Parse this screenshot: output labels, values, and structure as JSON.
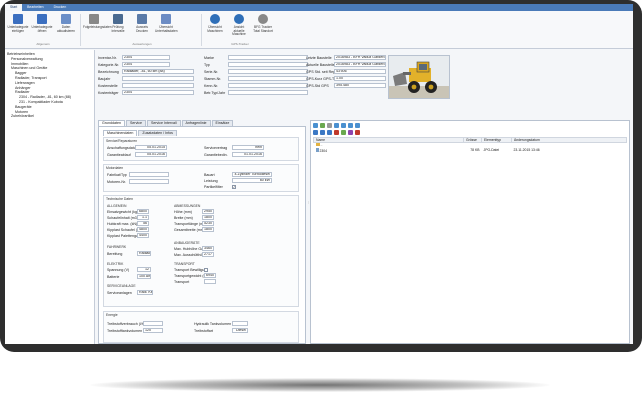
{
  "ribbon": {
    "tabs": [
      "Start",
      "Bearbeiten",
      "Drucken"
    ],
    "buttons": [
      {
        "label": "Unterkategorie einfügen",
        "color": "#3b6fc0"
      },
      {
        "label": "Unterkategorie öffnen",
        "color": "#3b6fc0"
      },
      {
        "label": "Daten aktualisieren",
        "color": "#6b8fc8"
      },
      {
        "label": "Folgeleistungsdaten",
        "color": "#888888"
      },
      {
        "label": "Prüfung Intervalle",
        "color": "#4a6a90"
      },
      {
        "label": "Ausweis Drucken",
        "color": "#5a7aa8"
      },
      {
        "label": "Übersicht Unterhaltsdaten",
        "color": "#6c8cc4"
      },
      {
        "label": "Übersicht Maschinen",
        "color": "#2f6fb8"
      },
      {
        "label": "Ansicht aktuelle Maschine",
        "color": "#2f6fb8"
      },
      {
        "label": "BFG Tracker Total Standort",
        "color": "#888888"
      }
    ],
    "groups": [
      "Allgemein",
      "Auswertungen",
      "GPS-Tracker"
    ]
  },
  "tree": [
    {
      "label": "Betriebseinheiten",
      "level": 0
    },
    {
      "label": "Personalverwaltung",
      "level": 1
    },
    {
      "label": "Immobilien",
      "level": 1
    },
    {
      "label": "Maschinen und Geräte",
      "level": 1
    },
    {
      "label": "Bagger",
      "level": 2
    },
    {
      "label": "Radlader, Transport",
      "level": 2
    },
    {
      "label": "Lieferwagen",
      "level": 2
    },
    {
      "label": "Anhänger",
      "level": 2
    },
    {
      "label": "Radlader",
      "level": 2
    },
    {
      "label": "2304 - Radlader, -81, 60 km (88)",
      "level": 3
    },
    {
      "label": "231 - Kompaktlader Kubota",
      "level": 3
    },
    {
      "label": "Baugeräte",
      "level": 2
    },
    {
      "label": "Motoren",
      "level": 2
    },
    {
      "label": "Zubehörartikel",
      "level": 1
    }
  ],
  "header": {
    "left_fields": [
      {
        "label": "Inventar-Nr.",
        "value": "2304"
      },
      {
        "label": "Kategorie-Nr.",
        "value": "2304"
      },
      {
        "label": "Bezeichnung",
        "value": "Radlader, -81, 60 km (88)"
      },
      {
        "label": "Baujahr",
        "value": ""
      },
      {
        "label": "Kostenstelle",
        "value": ""
      },
      {
        "label": "Kostenträger",
        "value": "2304"
      }
    ],
    "mid_fields": [
      {
        "label": "Marke",
        "value": ""
      },
      {
        "label": "Typ",
        "value": ""
      },
      {
        "label": "Serie-Nr.",
        "value": ""
      },
      {
        "label": "Stamm-Nr.",
        "value": ""
      },
      {
        "label": "Kenn-Nr.",
        "value": ""
      },
      {
        "label": "Betr.Typ/Jahr",
        "value": ""
      }
    ],
    "right_fields": [
      {
        "label": "Letzte Baustelle",
        "value": "2016983 - BFH Vaduz Garderobenliste"
      },
      {
        "label": "Aktuelle Baustelle",
        "value": "2016983 - BFH Vaduz Garderobenliste"
      },
      {
        "label": "GPS Std. seit Reparatur",
        "value": "43'506"
      },
      {
        "label": "GPS-Kurz GPS-Tracker",
        "value": "1.00"
      },
      {
        "label": "GPS-Std GPS",
        "value": "395.480"
      }
    ]
  },
  "subtabs": [
    "Grunddaten",
    "Service",
    "Service Intervall",
    "Anfragenlinie",
    "Einsätze"
  ],
  "inner_tabs": [
    "Maschinendaten",
    "Zusatzdaten / Infos"
  ],
  "sections": {
    "service": {
      "title": "Service/Reparaturen",
      "fields": [
        {
          "label": "Anschaffungsdatum",
          "value": "05.01.2015"
        },
        {
          "label": "Garantieablauf",
          "value": "05.01.2016"
        },
        {
          "label": "Servicevertrag",
          "value": "nein"
        },
        {
          "label": "Garantiebedin.",
          "value": "01.01.2016"
        }
      ]
    },
    "power": {
      "title": "Motordaten",
      "fields": [
        {
          "label": "Fabrikat/Typ",
          "value": ""
        },
        {
          "label": "Motoren-Nr.",
          "value": ""
        },
        {
          "label": "Bauart",
          "value": "4-Zylinder Turbodiesel"
        },
        {
          "label": "Leistung",
          "value": "60 kW"
        },
        {
          "label": "Partikelfilter",
          "value": "✓"
        }
      ]
    },
    "tech": {
      "title": "Technische Daten",
      "col1_title": "ALLGEMEIN",
      "col1": [
        {
          "label": "Einsatzgewicht (kg)",
          "value": "6800"
        },
        {
          "label": "Schaufelinhalt (m3)",
          "value": "1.1"
        },
        {
          "label": "Hubkraft max. (kN)",
          "value": "56"
        },
        {
          "label": "Kipplast Schaufel (kg)",
          "value": "4800"
        },
        {
          "label": "Kipplast Palettengabel (kg)",
          "value": "4400"
        }
      ],
      "col2_title": "ABMESSUNGEN",
      "col2": [
        {
          "label": "Höhe (mm)",
          "value": "2950"
        },
        {
          "label": "Breite (mm)",
          "value": "1800"
        },
        {
          "label": "Transportlänge (mm)",
          "value": "5230"
        },
        {
          "label": "Gesamtbreite (mm)",
          "value": "1800"
        }
      ],
      "col3_title": "FAHRWERK",
      "col3": [
        {
          "label": "Bereifung",
          "value": "Radlader 4x4"
        }
      ],
      "col4_title": "ANBAUGERÄTE",
      "col4": [
        {
          "label": "Max. Hubhöhe Gabel (mm)",
          "value": "3460"
        },
        {
          "label": "Max. Ausschütthöhe (mm)",
          "value": "2717"
        }
      ],
      "col5_title": "ELEKTRIK",
      "col5": [
        {
          "label": "Spannung (V)",
          "value": "12"
        },
        {
          "label": "Batterie",
          "value": "100 Ah"
        }
      ],
      "col6_title": "TRANSPORT",
      "col6": [
        {
          "label": "Transport Bewilligung",
          "value": ""
        },
        {
          "label": "Transportgewicht (kg)",
          "value": "6940"
        },
        {
          "label": "Transport",
          "value": ""
        }
      ],
      "col7_title": "SERVICEANLAGE",
      "col7": [
        {
          "label": "Serviceanlagen",
          "value": "Radl. Kettm"
        }
      ]
    },
    "energy": {
      "title": "Energie",
      "fields": [
        {
          "label": "Treibstoffverbrauch (l/h)",
          "value": ""
        },
        {
          "label": "Treibstofftankvolumen (l)",
          "value": "120"
        },
        {
          "label": "Hydraulik Tankvolumen (l)",
          "value": ""
        },
        {
          "label": "Treibstoffart",
          "value": "Diesel"
        }
      ]
    }
  },
  "files": {
    "columns": [
      "Name",
      "Grösse",
      "Elementtyp",
      "Änderungsdatum"
    ],
    "rows": [
      {
        "name": "..",
        "size": "",
        "type": "",
        "date": ""
      },
      {
        "name": "2304",
        "size": "78 KB",
        "type": "JPG-Datei",
        "date": "23.11.2015 13:46"
      }
    ]
  },
  "colors": {
    "accent": "#4a7ab8",
    "frame": "#2e2e2e"
  }
}
